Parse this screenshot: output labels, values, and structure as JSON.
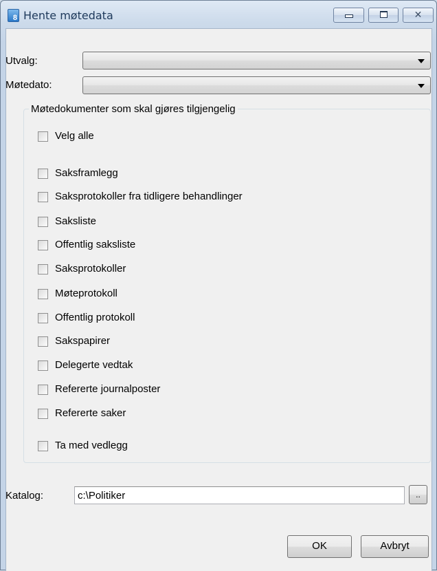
{
  "window": {
    "title": "Hente møtedata",
    "app_icon_glyph": "8",
    "minimize_icon": "minimize-icon",
    "maximize_icon": "maximize-icon",
    "close_icon": "close-icon",
    "close_glyph": "✕"
  },
  "form": {
    "utvalg_label": "Utvalg:",
    "utvalg_value": "",
    "motedato_label": "Møtedato:",
    "motedato_value": ""
  },
  "documents_group": {
    "title": "Møtedokumenter som skal gjøres tilgjengelig",
    "select_all": {
      "label": "Velg alle",
      "checked": false
    },
    "items": [
      {
        "label": "Saksframlegg",
        "checked": false
      },
      {
        "label": "Saksprotokoller fra tidligere behandlinger",
        "checked": false
      },
      {
        "label": "Saksliste",
        "checked": false
      },
      {
        "label": "Offentlig saksliste",
        "checked": false
      },
      {
        "label": "Saksprotokoller",
        "checked": false
      },
      {
        "label": "Møteprotokoll",
        "checked": false
      },
      {
        "label": "Offentlig protokoll",
        "checked": false
      },
      {
        "label": "Sakspapirer",
        "checked": false
      },
      {
        "label": "Delegerte vedtak",
        "checked": false
      },
      {
        "label": "Refererte journalposter",
        "checked": false
      },
      {
        "label": "Refererte saker",
        "checked": false
      }
    ],
    "include_attachments": {
      "label": "Ta med vedlegg",
      "checked": false
    }
  },
  "catalog": {
    "label": "Katalog:",
    "value": "c:\\Politiker",
    "browse_label": ".."
  },
  "buttons": {
    "ok_label": "OK",
    "cancel_label": "Avbryt"
  }
}
